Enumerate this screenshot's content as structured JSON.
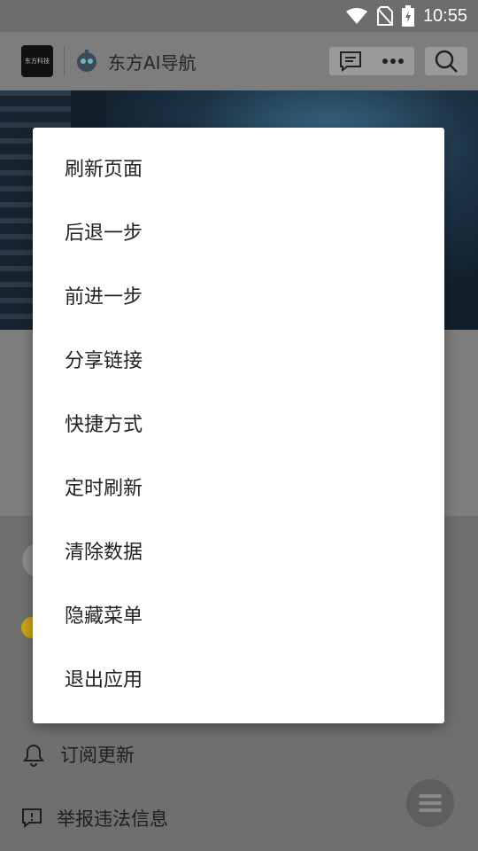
{
  "status_bar": {
    "time": "10:55",
    "icons": [
      "wifi-icon",
      "no-sim-icon",
      "battery-charging-icon"
    ]
  },
  "app_bar": {
    "logo_text": "东方科技",
    "title": "东方AI导航",
    "icons": [
      "chat-icon",
      "more-icon",
      "search-icon"
    ]
  },
  "menu": {
    "items": [
      "刷新页面",
      "后退一步",
      "前进一步",
      "分享链接",
      "快捷方式",
      "定时刷新",
      "清除数据",
      "隐藏菜单",
      "退出应用"
    ]
  },
  "lower_list": {
    "subscribe_label": "订阅更新",
    "report_label": "举报违法信息"
  },
  "colors": {
    "scrim": "#7a7a7a",
    "menu_background": "#ffffff",
    "menu_text": "#222222"
  }
}
